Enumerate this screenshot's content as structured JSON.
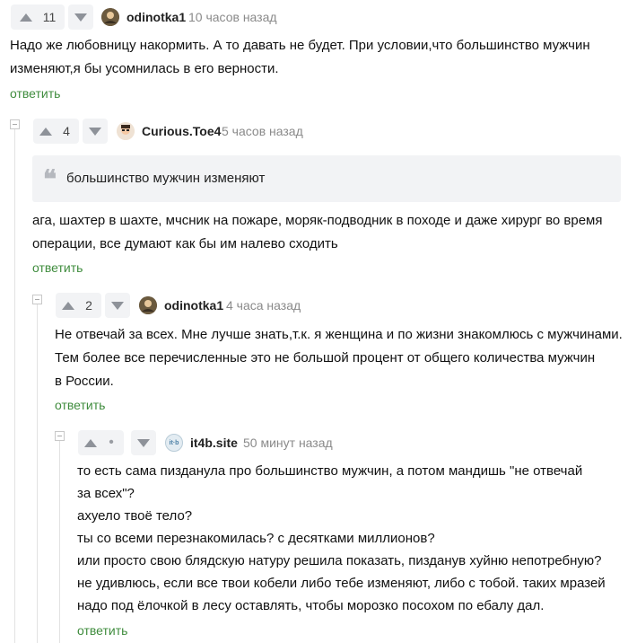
{
  "comments": [
    {
      "votes": "11",
      "username": "odinotka1",
      "time": "10 часов назад",
      "lines": [
        "Надо же любовницу накормить. А то давать не будет. При условии,что большинство мужчин",
        "изменяют,я бы усомнилась в его верности."
      ],
      "reply_label": "ответить"
    },
    {
      "votes": "4",
      "username": "Curious.Toe4",
      "time": "5 часов назад",
      "quote": "большинство мужчин изменяют",
      "lines": [
        "ага, шахтер в шахте, мчсник на пожаре, моряк-подводник в походе и даже хирург во время",
        "операции, все думают как бы им налево сходить"
      ],
      "reply_label": "ответить"
    },
    {
      "votes": "2",
      "username": "odinotka1",
      "time": "4 часа назад",
      "lines": [
        "Не отвечай за всех. Мне лучше знать,т.к. я женщина и по жизни знакомлюсь с мужчинами.",
        "Тем более все перечисленные это не большой процент от общего количества мужчин",
        "в России."
      ],
      "reply_label": "ответить"
    },
    {
      "votes": "•",
      "username": "it4b.site",
      "time": "50 минут назад",
      "avatar_text": "it·b",
      "lines": [
        "то есть сама пизданула про большинство мужчин, а потом мандишь \"не отвечай",
        "за всех\"?",
        "ахуело твоё тело?",
        "ты со всеми перезнакомилась? с десятками миллионов?",
        "или просто свою блядскую натуру решила показать, пизданув хуйню непотребную?",
        "не удивлюсь, если все твои кобели либо тебе изменяют, либо с тобой. таких мразей",
        "надо под ёлочкой в лесу оставлять, чтобы морозко посохом по ебалу дал."
      ],
      "reply_label": "ответить"
    }
  ],
  "colors": {
    "reply_link": "#3f8c3d",
    "vote_bg": "#f2f3f5",
    "quote_bg": "#f2f3f5",
    "muted": "#8a8a8a"
  }
}
